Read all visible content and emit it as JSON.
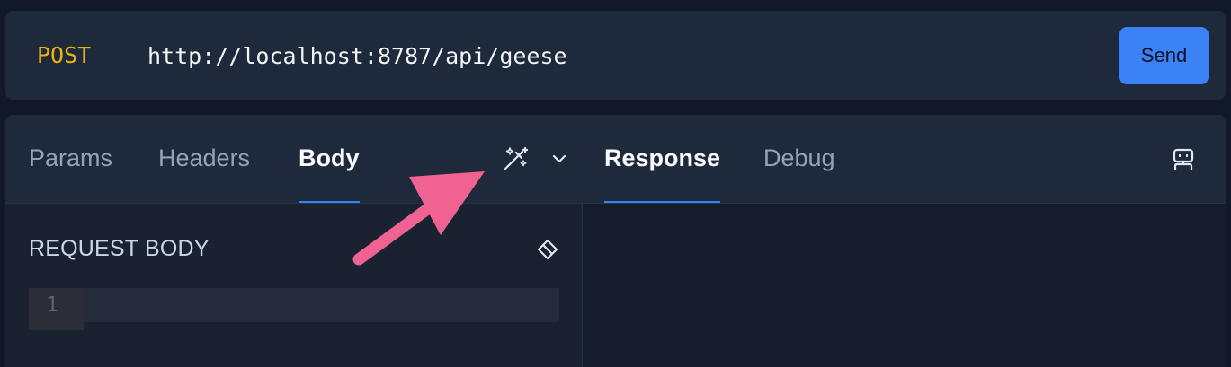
{
  "request": {
    "method": "POST",
    "url": "http://localhost:8787/api/geese",
    "send_label": "Send"
  },
  "tabs": {
    "request_tabs": [
      {
        "label": "Params"
      },
      {
        "label": "Headers"
      },
      {
        "label": "Body"
      }
    ],
    "response_tabs": [
      {
        "label": "Response"
      },
      {
        "label": "Debug"
      }
    ],
    "active_request_tab": "Body",
    "active_response_tab": "Response"
  },
  "body_panel": {
    "title": "REQUEST BODY",
    "line_numbers": [
      "1"
    ]
  },
  "icons": {
    "magic": "magic-wand-icon",
    "chevron": "chevron-down-icon",
    "eraser": "eraser-icon",
    "robot": "robot-icon"
  },
  "colors": {
    "accent": "#3b82f6",
    "method": "#eab308",
    "annotation_arrow": "#f06292"
  }
}
